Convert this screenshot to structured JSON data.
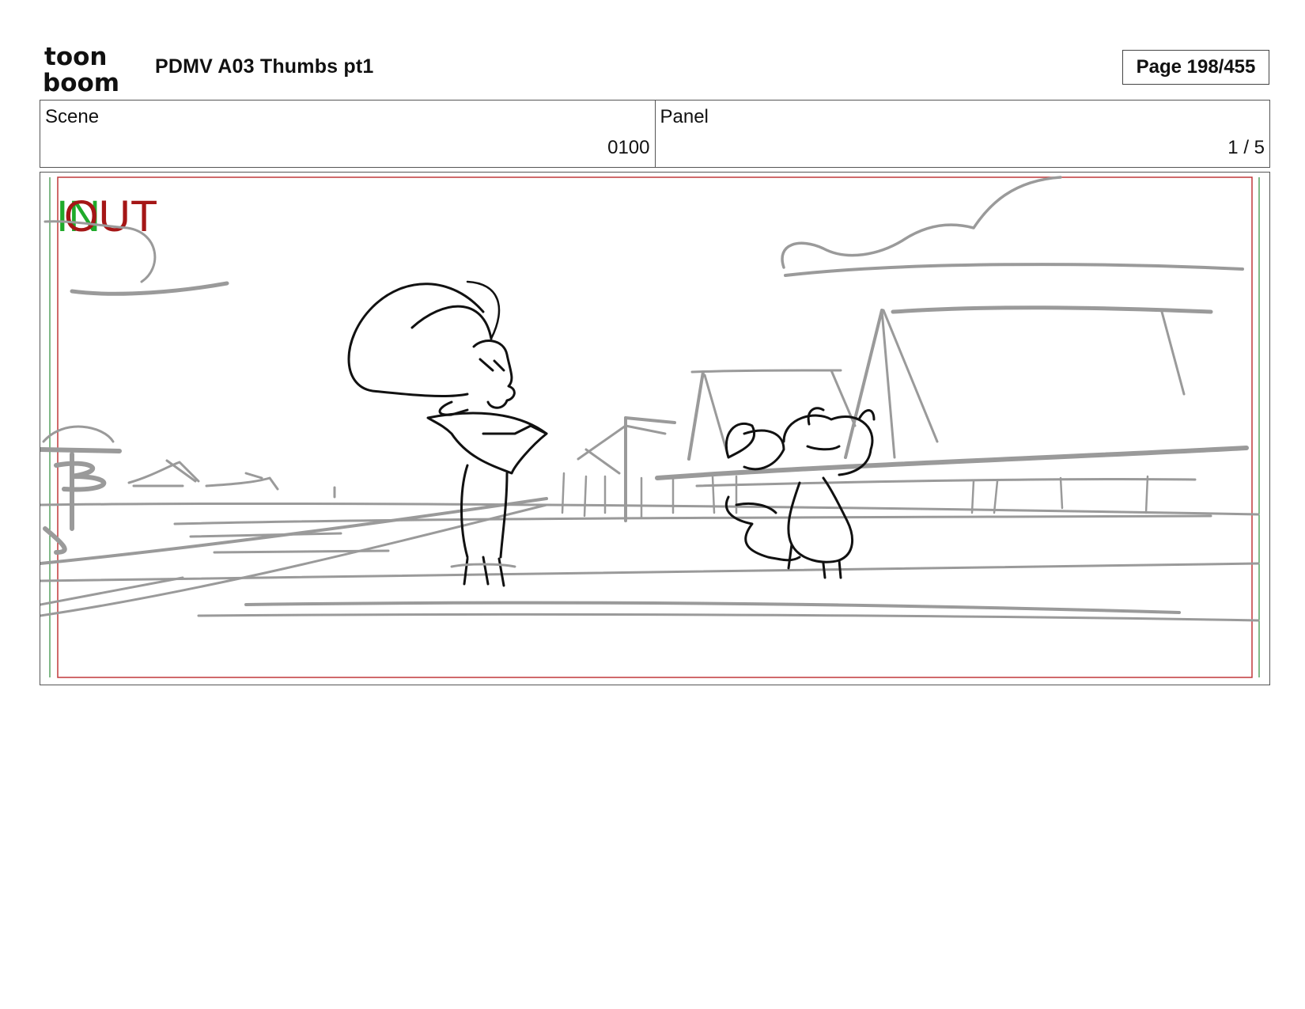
{
  "header": {
    "logo_lines": [
      "toon",
      "boom"
    ],
    "title": "PDMV A03 Thumbs pt1",
    "page": "Page 198/455"
  },
  "info": {
    "scene_label": "Scene",
    "scene_value": "0100",
    "panel_label": "Panel",
    "panel_value": "1 / 5"
  },
  "panel": {
    "in_label": "IN",
    "out_label": "OUT",
    "colors": {
      "in": "#1faa2a",
      "out": "#a51616",
      "safe_red": "#c0383a",
      "safe_green": "#2e8b3a",
      "sketch_gray": "#9a9a9a",
      "ink": "#111111"
    }
  }
}
